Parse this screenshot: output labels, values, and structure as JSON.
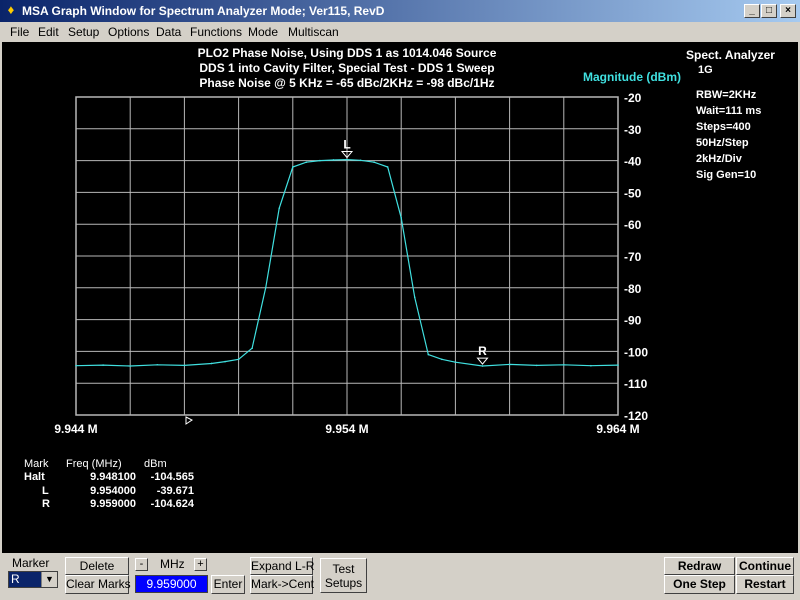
{
  "window": {
    "title": "MSA Graph Window for Spectrum Analyzer Mode; Ver115, RevD",
    "min_glyph": "_",
    "max_glyph": "□",
    "close_glyph": "×"
  },
  "menu": [
    "File",
    "Edit",
    "Setup",
    "Options",
    "Data",
    "Functions",
    "Mode",
    "Multiscan"
  ],
  "graph": {
    "header_lines": [
      "PLO2 Phase Noise, Using DDS 1 as 1014.046 Source",
      "DDS 1 into Cavity Filter, Special Test - DDS 1 Sweep",
      "Phase Noise @ 5 KHz = -65 dBc/2KHz = -98 dBc/1Hz"
    ],
    "y_axis_title": "Magnitude (dBm)",
    "y_tick_labels": [
      "-20",
      "-30",
      "-40",
      "-50",
      "-60",
      "-70",
      "-80",
      "-90",
      "-100",
      "-110",
      "-120"
    ],
    "x_tick_labels": [
      "9.944 M",
      "9.954 M",
      "9.964 M"
    ],
    "settings": [
      "Spect. Analyzer",
      "1G",
      "RBW=2KHz",
      "Wait=111 ms",
      "Steps=400",
      "50Hz/Step",
      "2kHz/Div",
      "Sig Gen=10"
    ],
    "marker_L_label": "L",
    "marker_R_label": "R",
    "marker_table": {
      "headers": [
        "Mark",
        "Freq (MHz)",
        "dBm"
      ],
      "rows": [
        [
          "Halt",
          "9.948100",
          "-104.565"
        ],
        [
          "L",
          "9.954000",
          "-39.671"
        ],
        [
          "R",
          "9.959000",
          "-104.624"
        ]
      ]
    },
    "colors": {
      "background": "#000000",
      "grid": "#b8b8b8",
      "trace": "#40e0e0",
      "axis_title": "#40e0e0"
    }
  },
  "chart_data": {
    "type": "line",
    "title": "PLO2 Phase Noise, Using DDS 1 as 1014.046 Source",
    "xlabel": "",
    "ylabel": "Magnitude (dBm)",
    "xlim": [
      9.944,
      9.964
    ],
    "ylim": [
      -120,
      -20
    ],
    "grid": true,
    "x": [
      9.944,
      9.945,
      9.946,
      9.947,
      9.948,
      9.949,
      9.9495,
      9.95,
      9.9505,
      9.951,
      9.9515,
      9.952,
      9.9525,
      9.953,
      9.9535,
      9.954,
      9.9545,
      9.955,
      9.9555,
      9.956,
      9.9565,
      9.957,
      9.9575,
      9.958,
      9.959,
      9.96,
      9.961,
      9.962,
      9.963,
      9.964
    ],
    "y": [
      -104.5,
      -104.3,
      -104.6,
      -104.2,
      -104.4,
      -103.8,
      -103.2,
      -102.5,
      -99,
      -80,
      -55,
      -42,
      -40.5,
      -40,
      -39.8,
      -39.7,
      -39.9,
      -40.5,
      -42,
      -58,
      -83,
      -101,
      -102.5,
      -103.4,
      -104.6,
      -104.1,
      -104.4,
      -104.2,
      -104.5,
      -104.3
    ],
    "markers": [
      {
        "name": "L",
        "x": 9.954,
        "y": -39.671
      },
      {
        "name": "R",
        "x": 9.959,
        "y": -104.624
      },
      {
        "name": "Halt",
        "x": 9.9481,
        "y": -104.565
      }
    ]
  },
  "bottom": {
    "marker_label": "Marker",
    "marker_value": "R",
    "marker_arrow": "▼",
    "delete_label": "Delete",
    "clear_marks_label": "Clear Marks",
    "minus_label": "-",
    "mhz_label": "MHz",
    "plus_label": "+",
    "mhz_value": "9.959000",
    "enter_label": "Enter",
    "expand_label": "Expand L-R",
    "mark_cent_label": "Mark->Cent",
    "test_setups_line1": "Test",
    "test_setups_line2": "Setups",
    "redraw_label": "Redraw",
    "continue_label": "Continue",
    "one_step_label": "One Step",
    "restart_label": "Restart"
  }
}
